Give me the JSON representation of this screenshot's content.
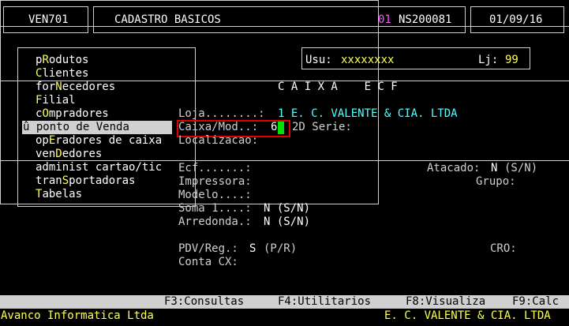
{
  "header": {
    "program": "VEN701",
    "title": "CADASTRO BASICOS",
    "company_code": "01",
    "terminal_id": "NS200081",
    "date": "01/09/16"
  },
  "user_panel": {
    "user_label": "Usu:",
    "user_value": "xxxxxxxx",
    "store_label": "Lj:",
    "store_value": "99"
  },
  "menu": {
    "items": [
      {
        "pre": "p",
        "key": "R",
        "post": "odutos"
      },
      {
        "pre": "",
        "key": "C",
        "post": "lientes"
      },
      {
        "pre": "for",
        "key": "N",
        "post": "ecedores"
      },
      {
        "pre": "",
        "key": "F",
        "post": "ilial"
      },
      {
        "pre": "c",
        "key": "O",
        "post": "mpradores"
      },
      {
        "pre": "û ponto de ",
        "key": "V",
        "post": "enda"
      },
      {
        "pre": "op",
        "key": "E",
        "post": "radores de caixa"
      },
      {
        "pre": "ven",
        "key": "D",
        "post": "edores"
      },
      {
        "pre": "administ cartao/tic",
        "key": "",
        "post": ""
      },
      {
        "pre": "tran",
        "key": "S",
        "post": "portadoras"
      },
      {
        "pre": "",
        "key": "T",
        "post": "abelas"
      }
    ]
  },
  "dialog": {
    "title": "C A I X A    E C F",
    "loja_label": "Loja........:",
    "loja_value": "1 E. C. VALENTE & CIA. LTDA",
    "caixa_label": "Caixa/Mod..:",
    "caixa_value": "6",
    "serie_label": "2D Serie:",
    "localizacao_label": "Localizacao:",
    "ecf_label": "Ecf.......:",
    "atacado_label": "Atacado:",
    "atacado_value": "N",
    "atacado_hint": "(S/N)",
    "impressora_label": "Impressora:",
    "grupo_label": "Grupo:",
    "modelo_label": "Modelo....:",
    "soma_label": "Soma 1....:",
    "soma_value": "N (S/N)",
    "arredonda_label": "Arredonda.:",
    "arredonda_value": "N (S/N)",
    "pdv_label": "PDV/Reg.:",
    "pdv_value": "S",
    "pdv_hint": "(P/R)",
    "cro_label": "CRO:",
    "conta_label": "Conta CX:"
  },
  "footer": {
    "f3": "F3:Consultas",
    "f4": "F4:Utilitarios",
    "f8": "F8:Visualiza",
    "f9": "F9:Calc"
  },
  "status": {
    "vendor": "Avanco Informatica Ltda",
    "company": "E. C. VALENTE & CIA. LTDA"
  }
}
